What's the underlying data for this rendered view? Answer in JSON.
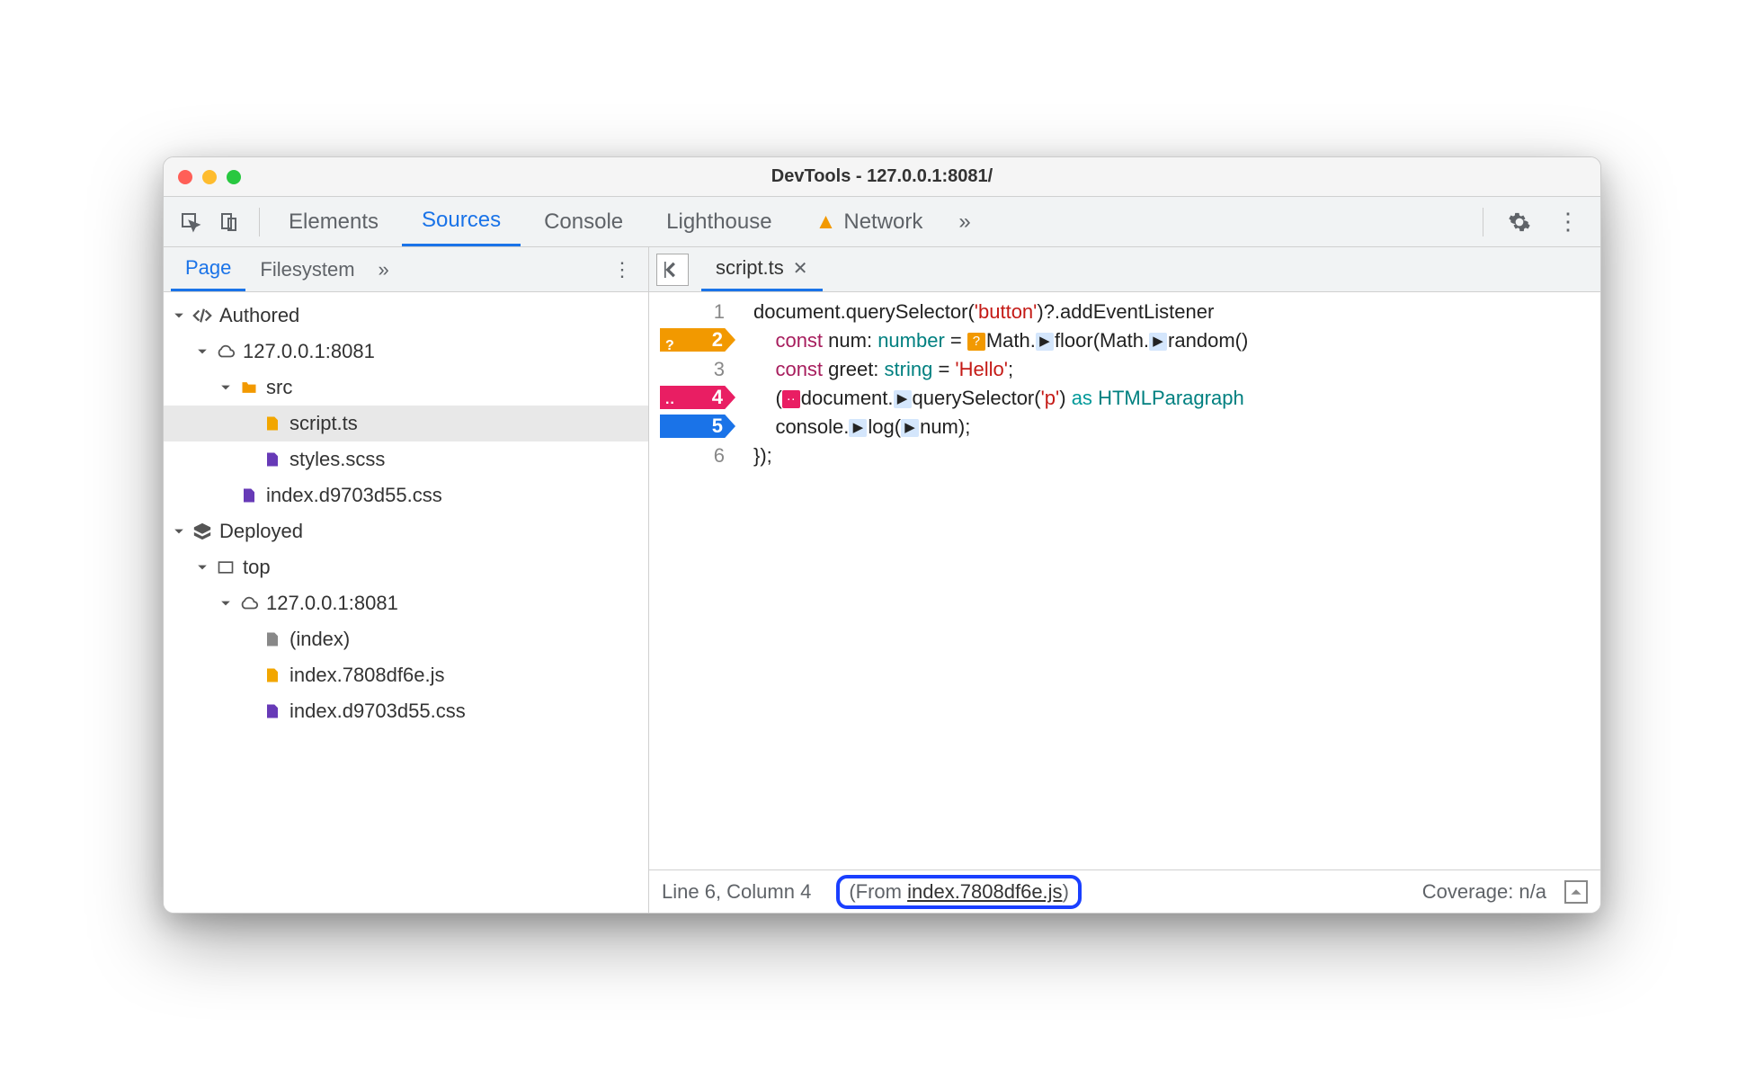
{
  "window": {
    "title": "DevTools - 127.0.0.1:8081/"
  },
  "toolbar": {
    "tabs": [
      "Elements",
      "Sources",
      "Console",
      "Lighthouse",
      "Network"
    ],
    "active": "Sources",
    "more": "»"
  },
  "sidebar": {
    "tabs": [
      "Page",
      "Filesystem"
    ],
    "active": "Page",
    "more": "»",
    "tree": {
      "authored": {
        "label": "Authored",
        "host": "127.0.0.1:8081",
        "folder": "src",
        "files": [
          "script.ts",
          "styles.scss"
        ],
        "rootFile": "index.d9703d55.css"
      },
      "deployed": {
        "label": "Deployed",
        "top": "top",
        "host": "127.0.0.1:8081",
        "files": [
          "(index)",
          "index.7808df6e.js",
          "index.d9703d55.css"
        ]
      }
    }
  },
  "editor": {
    "filename": "script.ts",
    "gutter": [
      "1",
      "2",
      "3",
      "4",
      "5",
      "6"
    ],
    "breakpoints": {
      "2": {
        "color": "orange",
        "label": "?"
      },
      "4": {
        "color": "pink",
        "label": "··"
      },
      "5": {
        "color": "blue",
        "label": ""
      }
    },
    "code_tokens": [
      [
        [
          "",
          "document.querySelector("
        ],
        [
          "str",
          "'button'"
        ],
        [
          "",
          ")?.addEventListener"
        ]
      ],
      [
        [
          "",
          "    "
        ],
        [
          "kw",
          "const"
        ],
        [
          "",
          " num: "
        ],
        [
          "type",
          "number"
        ],
        [
          "",
          " = "
        ],
        [
          "ann-orange",
          "?"
        ],
        [
          "",
          "Math."
        ],
        [
          "ann-blue",
          "▶"
        ],
        [
          "",
          "floor(Math."
        ],
        [
          "ann-blue",
          "▶"
        ],
        [
          "",
          "random()"
        ]
      ],
      [
        [
          "",
          "    "
        ],
        [
          "kw",
          "const"
        ],
        [
          "",
          " greet: "
        ],
        [
          "type",
          "string"
        ],
        [
          "",
          " = "
        ],
        [
          "str",
          "'Hello'"
        ],
        [
          "",
          ";"
        ]
      ],
      [
        [
          "",
          "    ("
        ],
        [
          "ann-pink",
          "··"
        ],
        [
          "",
          "document."
        ],
        [
          "ann-blue",
          "▶"
        ],
        [
          "",
          "querySelector("
        ],
        [
          "str",
          "'p'"
        ],
        [
          "",
          ") "
        ],
        [
          "as",
          "as"
        ],
        [
          "",
          " "
        ],
        [
          "type",
          "HTMLParagraph"
        ]
      ],
      [
        [
          "",
          "    console."
        ],
        [
          "ann-blue",
          "▶"
        ],
        [
          "",
          "log("
        ],
        [
          "ann-blue",
          "▶"
        ],
        [
          "",
          "num);"
        ]
      ],
      [
        [
          "",
          "});"
        ]
      ]
    ]
  },
  "statusbar": {
    "position": "Line 6, Column 4",
    "from_prefix": "(From ",
    "from_link": "index.7808df6e.js",
    "from_suffix": ")",
    "coverage": "Coverage: n/a"
  }
}
